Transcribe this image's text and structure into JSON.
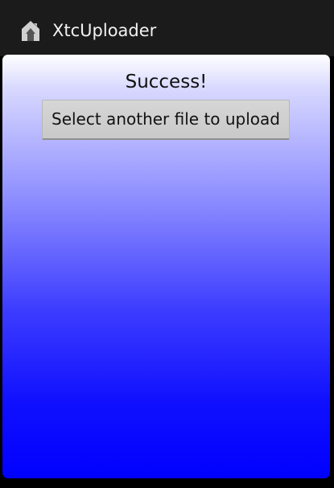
{
  "app": {
    "title": "XtcUploader",
    "icon": "home-upload-icon"
  },
  "main": {
    "status": "Success!",
    "button_label": "Select another file to upload"
  },
  "colors": {
    "action_bar": "#1b1b1b",
    "gradient_top": "#ffffff",
    "gradient_bottom": "#0000ff",
    "button": "#cfcfcf"
  }
}
